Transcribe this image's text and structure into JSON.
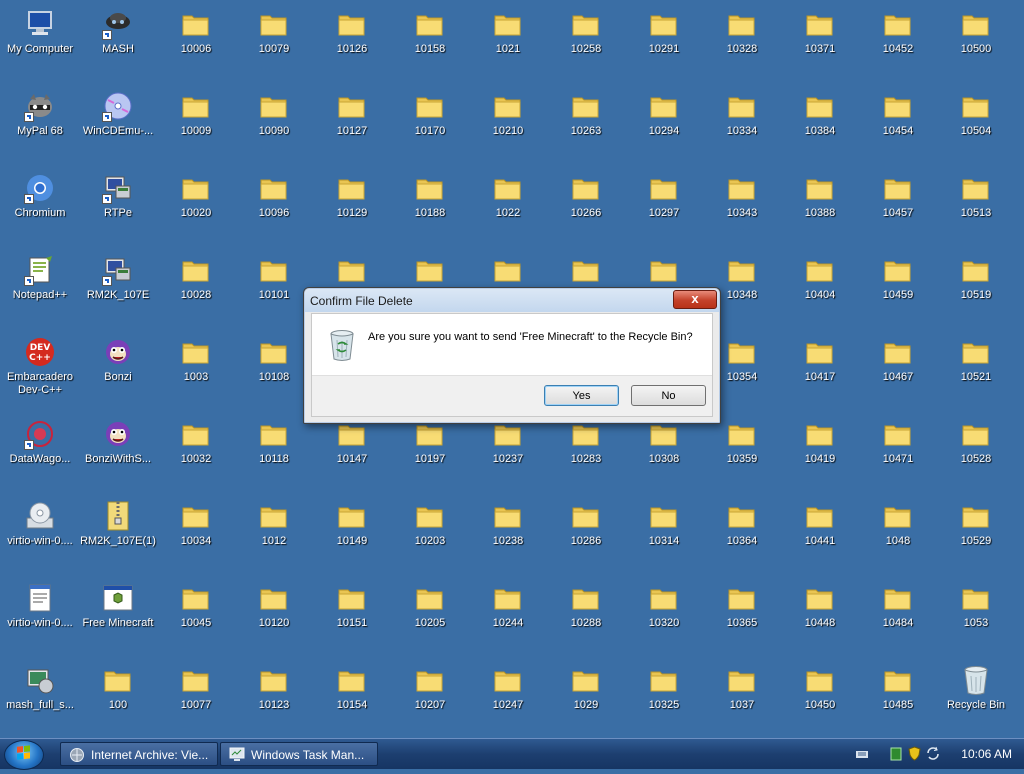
{
  "desktop": {
    "icons": [
      {
        "label": "My Computer",
        "icon": "computer-icon",
        "col": 0,
        "row": 0,
        "shortcut": false
      },
      {
        "label": "MASH",
        "icon": "mash-icon",
        "col": 1,
        "row": 0,
        "shortcut": true
      },
      {
        "label": "10006",
        "icon": "folder-icon",
        "col": 2,
        "row": 0
      },
      {
        "label": "10079",
        "icon": "folder-icon",
        "col": 3,
        "row": 0
      },
      {
        "label": "10126",
        "icon": "folder-icon",
        "col": 4,
        "row": 0
      },
      {
        "label": "10158",
        "icon": "folder-icon",
        "col": 5,
        "row": 0
      },
      {
        "label": "1021",
        "icon": "folder-icon",
        "col": 6,
        "row": 0
      },
      {
        "label": "10258",
        "icon": "folder-icon",
        "col": 7,
        "row": 0
      },
      {
        "label": "10291",
        "icon": "folder-icon",
        "col": 8,
        "row": 0
      },
      {
        "label": "10328",
        "icon": "folder-icon",
        "col": 9,
        "row": 0
      },
      {
        "label": "10371",
        "icon": "folder-icon",
        "col": 10,
        "row": 0
      },
      {
        "label": "10452",
        "icon": "folder-icon",
        "col": 11,
        "row": 0
      },
      {
        "label": "10500",
        "icon": "folder-icon",
        "col": 12,
        "row": 0
      },
      {
        "label": "MyPal 68",
        "icon": "mypal-icon",
        "col": 0,
        "row": 1,
        "shortcut": true
      },
      {
        "label": "WinCDEmu-...",
        "icon": "wincdemu-icon",
        "col": 1,
        "row": 1,
        "shortcut": true
      },
      {
        "label": "10009",
        "icon": "folder-icon",
        "col": 2,
        "row": 1
      },
      {
        "label": "10090",
        "icon": "folder-icon",
        "col": 3,
        "row": 1
      },
      {
        "label": "10127",
        "icon": "folder-icon",
        "col": 4,
        "row": 1
      },
      {
        "label": "10170",
        "icon": "folder-icon",
        "col": 5,
        "row": 1
      },
      {
        "label": "10210",
        "icon": "folder-icon",
        "col": 6,
        "row": 1
      },
      {
        "label": "10263",
        "icon": "folder-icon",
        "col": 7,
        "row": 1
      },
      {
        "label": "10294",
        "icon": "folder-icon",
        "col": 8,
        "row": 1
      },
      {
        "label": "10334",
        "icon": "folder-icon",
        "col": 9,
        "row": 1
      },
      {
        "label": "10384",
        "icon": "folder-icon",
        "col": 10,
        "row": 1
      },
      {
        "label": "10454",
        "icon": "folder-icon",
        "col": 11,
        "row": 1
      },
      {
        "label": "10504",
        "icon": "folder-icon",
        "col": 12,
        "row": 1
      },
      {
        "label": "Chromium",
        "icon": "chromium-icon",
        "col": 0,
        "row": 2,
        "shortcut": true
      },
      {
        "label": "RTPe",
        "icon": "rtpe-icon",
        "col": 1,
        "row": 2,
        "shortcut": true
      },
      {
        "label": "10020",
        "icon": "folder-icon",
        "col": 2,
        "row": 2
      },
      {
        "label": "10096",
        "icon": "folder-icon",
        "col": 3,
        "row": 2
      },
      {
        "label": "10129",
        "icon": "folder-icon",
        "col": 4,
        "row": 2
      },
      {
        "label": "10188",
        "icon": "folder-icon",
        "col": 5,
        "row": 2
      },
      {
        "label": "1022",
        "icon": "folder-icon",
        "col": 6,
        "row": 2
      },
      {
        "label": "10266",
        "icon": "folder-icon",
        "col": 7,
        "row": 2
      },
      {
        "label": "10297",
        "icon": "folder-icon",
        "col": 8,
        "row": 2
      },
      {
        "label": "10343",
        "icon": "folder-icon",
        "col": 9,
        "row": 2
      },
      {
        "label": "10388",
        "icon": "folder-icon",
        "col": 10,
        "row": 2
      },
      {
        "label": "10457",
        "icon": "folder-icon",
        "col": 11,
        "row": 2
      },
      {
        "label": "10513",
        "icon": "folder-icon",
        "col": 12,
        "row": 2
      },
      {
        "label": "Notepad++",
        "icon": "notepadpp-icon",
        "col": 0,
        "row": 3,
        "shortcut": true
      },
      {
        "label": "RM2K_107E",
        "icon": "rm2k-icon",
        "col": 1,
        "row": 3,
        "shortcut": true
      },
      {
        "label": "10028",
        "icon": "folder-icon",
        "col": 2,
        "row": 3
      },
      {
        "label": "10101",
        "icon": "folder-icon",
        "col": 3,
        "row": 3
      },
      {
        "label": "",
        "icon": "folder-icon",
        "col": 4,
        "row": 3
      },
      {
        "label": "",
        "icon": "folder-icon",
        "col": 5,
        "row": 3
      },
      {
        "label": "",
        "icon": "folder-icon",
        "col": 6,
        "row": 3
      },
      {
        "label": "",
        "icon": "folder-icon",
        "col": 7,
        "row": 3
      },
      {
        "label": "",
        "icon": "folder-icon",
        "col": 8,
        "row": 3
      },
      {
        "label": "10348",
        "icon": "folder-icon",
        "col": 9,
        "row": 3
      },
      {
        "label": "10404",
        "icon": "folder-icon",
        "col": 10,
        "row": 3
      },
      {
        "label": "10459",
        "icon": "folder-icon",
        "col": 11,
        "row": 3
      },
      {
        "label": "10519",
        "icon": "folder-icon",
        "col": 12,
        "row": 3
      },
      {
        "label": "Embarcadero\nDev-C++",
        "icon": "devcpp-icon",
        "col": 0,
        "row": 4,
        "shortcut": false
      },
      {
        "label": "Bonzi",
        "icon": "bonzi-icon",
        "col": 1,
        "row": 4,
        "shortcut": false
      },
      {
        "label": "1003",
        "icon": "folder-icon",
        "col": 2,
        "row": 4
      },
      {
        "label": "10108",
        "icon": "folder-icon",
        "col": 3,
        "row": 4
      },
      {
        "label": "10354",
        "icon": "folder-icon",
        "col": 9,
        "row": 4
      },
      {
        "label": "10417",
        "icon": "folder-icon",
        "col": 10,
        "row": 4
      },
      {
        "label": "10467",
        "icon": "folder-icon",
        "col": 11,
        "row": 4
      },
      {
        "label": "10521",
        "icon": "folder-icon",
        "col": 12,
        "row": 4
      },
      {
        "label": "DataWago...",
        "icon": "datawagon-icon",
        "col": 0,
        "row": 5,
        "shortcut": true
      },
      {
        "label": "BonziWithS...",
        "icon": "bonzi-icon",
        "col": 1,
        "row": 5,
        "shortcut": false
      },
      {
        "label": "10032",
        "icon": "folder-icon",
        "col": 2,
        "row": 5
      },
      {
        "label": "10118",
        "icon": "folder-icon",
        "col": 3,
        "row": 5
      },
      {
        "label": "10147",
        "icon": "folder-icon",
        "col": 4,
        "row": 5
      },
      {
        "label": "10197",
        "icon": "folder-icon",
        "col": 5,
        "row": 5
      },
      {
        "label": "10237",
        "icon": "folder-icon",
        "col": 6,
        "row": 5
      },
      {
        "label": "10283",
        "icon": "folder-icon",
        "col": 7,
        "row": 5
      },
      {
        "label": "10308",
        "icon": "folder-icon",
        "col": 8,
        "row": 5
      },
      {
        "label": "10359",
        "icon": "folder-icon",
        "col": 9,
        "row": 5
      },
      {
        "label": "10419",
        "icon": "folder-icon",
        "col": 10,
        "row": 5
      },
      {
        "label": "10471",
        "icon": "folder-icon",
        "col": 11,
        "row": 5
      },
      {
        "label": "10528",
        "icon": "folder-icon",
        "col": 12,
        "row": 5
      },
      {
        "label": "virtio-win-0....",
        "icon": "disc-installer-icon",
        "col": 0,
        "row": 6,
        "shortcut": false
      },
      {
        "label": "RM2K_107E(1)",
        "icon": "zip-archive-icon",
        "col": 1,
        "row": 6,
        "shortcut": false
      },
      {
        "label": "10034",
        "icon": "folder-icon",
        "col": 2,
        "row": 6
      },
      {
        "label": "1012",
        "icon": "folder-icon",
        "col": 3,
        "row": 6
      },
      {
        "label": "10149",
        "icon": "folder-icon",
        "col": 4,
        "row": 6
      },
      {
        "label": "10203",
        "icon": "folder-icon",
        "col": 5,
        "row": 6
      },
      {
        "label": "10238",
        "icon": "folder-icon",
        "col": 6,
        "row": 6
      },
      {
        "label": "10286",
        "icon": "folder-icon",
        "col": 7,
        "row": 6
      },
      {
        "label": "10314",
        "icon": "folder-icon",
        "col": 8,
        "row": 6
      },
      {
        "label": "10364",
        "icon": "folder-icon",
        "col": 9,
        "row": 6
      },
      {
        "label": "10441",
        "icon": "folder-icon",
        "col": 10,
        "row": 6
      },
      {
        "label": "1048",
        "icon": "folder-icon",
        "col": 11,
        "row": 6
      },
      {
        "label": "10529",
        "icon": "folder-icon",
        "col": 12,
        "row": 6
      },
      {
        "label": "virtio-win-0....",
        "icon": "text-file-icon",
        "col": 0,
        "row": 7,
        "shortcut": false
      },
      {
        "label": "Free Minecraft",
        "icon": "program-window-icon",
        "col": 1,
        "row": 7,
        "shortcut": false
      },
      {
        "label": "10045",
        "icon": "folder-icon",
        "col": 2,
        "row": 7
      },
      {
        "label": "10120",
        "icon": "folder-icon",
        "col": 3,
        "row": 7
      },
      {
        "label": "10151",
        "icon": "folder-icon",
        "col": 4,
        "row": 7
      },
      {
        "label": "10205",
        "icon": "folder-icon",
        "col": 5,
        "row": 7
      },
      {
        "label": "10244",
        "icon": "folder-icon",
        "col": 6,
        "row": 7
      },
      {
        "label": "10288",
        "icon": "folder-icon",
        "col": 7,
        "row": 7
      },
      {
        "label": "10320",
        "icon": "folder-icon",
        "col": 8,
        "row": 7
      },
      {
        "label": "10365",
        "icon": "folder-icon",
        "col": 9,
        "row": 7
      },
      {
        "label": "10448",
        "icon": "folder-icon",
        "col": 10,
        "row": 7
      },
      {
        "label": "10484",
        "icon": "folder-icon",
        "col": 11,
        "row": 7
      },
      {
        "label": "1053",
        "icon": "folder-icon",
        "col": 12,
        "row": 7
      },
      {
        "label": "mash_full_s...",
        "icon": "installer-icon",
        "col": 0,
        "row": 8,
        "shortcut": false
      },
      {
        "label": "100",
        "icon": "folder-icon",
        "col": 1,
        "row": 8
      },
      {
        "label": "10077",
        "icon": "folder-icon",
        "col": 2,
        "row": 8
      },
      {
        "label": "10123",
        "icon": "folder-icon",
        "col": 3,
        "row": 8
      },
      {
        "label": "10154",
        "icon": "folder-icon",
        "col": 4,
        "row": 8
      },
      {
        "label": "10207",
        "icon": "folder-icon",
        "col": 5,
        "row": 8
      },
      {
        "label": "10247",
        "icon": "folder-icon",
        "col": 6,
        "row": 8
      },
      {
        "label": "1029",
        "icon": "folder-icon",
        "col": 7,
        "row": 8
      },
      {
        "label": "10325",
        "icon": "folder-icon",
        "col": 8,
        "row": 8
      },
      {
        "label": "1037",
        "icon": "folder-icon",
        "col": 9,
        "row": 8
      },
      {
        "label": "10450",
        "icon": "folder-icon",
        "col": 10,
        "row": 8
      },
      {
        "label": "10485",
        "icon": "folder-icon",
        "col": 11,
        "row": 8
      },
      {
        "label": "Recycle Bin",
        "icon": "recycle-bin-icon",
        "col": 12,
        "row": 8,
        "shortcut": false
      }
    ]
  },
  "dialog": {
    "title": "Confirm File Delete",
    "close_label": "x",
    "message": "Are you sure you want to send 'Free Minecraft' to the Recycle Bin?",
    "icon": "recycle-bin-icon",
    "yes_label": "Yes",
    "no_label": "No"
  },
  "taskbar": {
    "start_icon": "windows-orb-icon",
    "tasks": [
      {
        "label": "Internet Archive: Vie...",
        "icon": "browser-icon"
      },
      {
        "label": "Windows Task Man...",
        "icon": "task-manager-icon"
      }
    ],
    "tray_icons": [
      "keyboard-icon",
      "network-icon",
      "security-shield-icon",
      "sync-icon"
    ],
    "clock": "10:06 AM"
  },
  "colors": {
    "desktop_bg": "#3a6ea5",
    "folder": "#f6d86b",
    "taskbar": "#1d3f70"
  }
}
